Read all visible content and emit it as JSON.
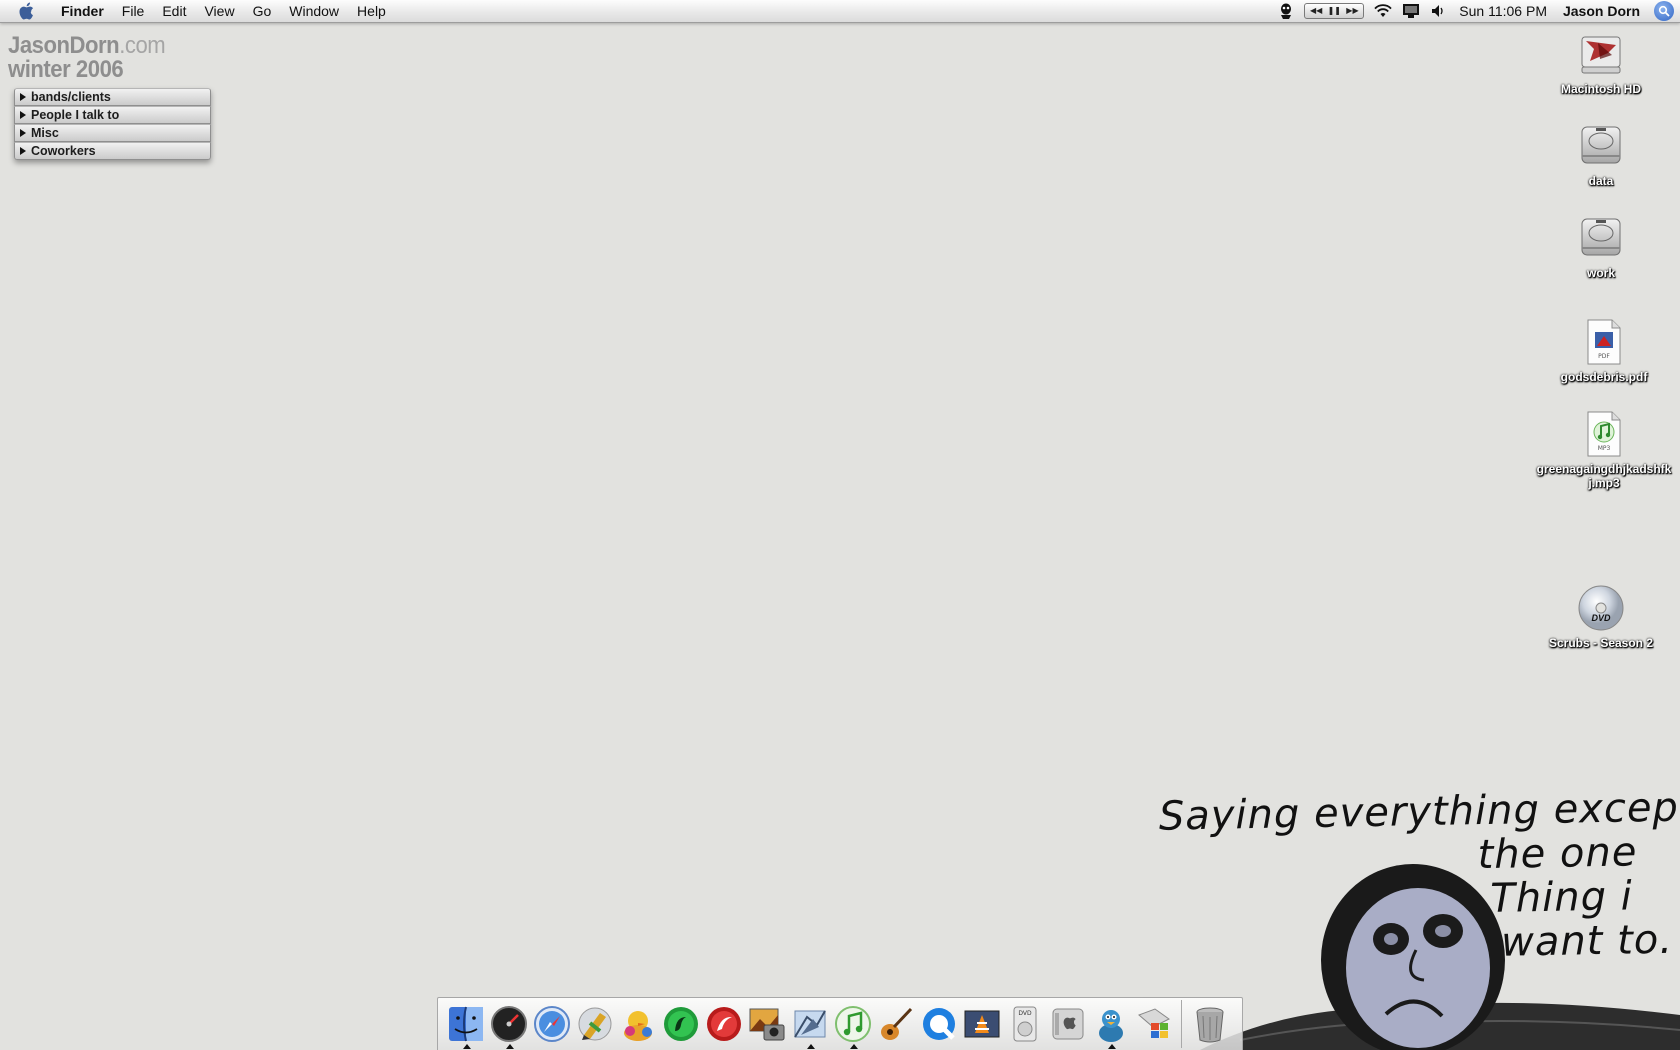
{
  "menubar": {
    "apple_icon": "apple-icon",
    "app_name": "Finder",
    "menus": [
      "File",
      "Edit",
      "View",
      "Go",
      "Window",
      "Help"
    ],
    "status_icons": [
      "script-menu-icon",
      "itunes-transport-control",
      "wifi-icon",
      "display-icon",
      "volume-icon"
    ],
    "clock": "Sun 11:06 PM",
    "user": "Jason Dorn",
    "spotlight_icon": "spotlight-icon"
  },
  "widget": {
    "title_main": "JasonDorn",
    "title_suffix": ".com",
    "subtitle": "winter 2006",
    "items": [
      "bands/clients",
      "People I talk to",
      "Misc",
      "Coworkers"
    ]
  },
  "desktop_icons": [
    {
      "label": "Macintosh HD",
      "icon": "hard-drive-icon"
    },
    {
      "label": "data",
      "icon": "hard-drive-icon"
    },
    {
      "label": "work",
      "icon": "hard-drive-icon"
    },
    {
      "label": "godsdebris.pdf",
      "icon": "pdf-file-icon"
    },
    {
      "label": "greenagaingdhjkadshfkj.mp3",
      "icon": "mp3-file-icon"
    },
    {
      "label": "Scrubs - Season 2",
      "icon": "dvd-icon"
    }
  ],
  "wallpaper": {
    "caption_line1": "Saying everything except",
    "caption_line2": "the one",
    "caption_line3": "Thing i",
    "caption_line4": "want to."
  },
  "dock": {
    "apps": [
      {
        "icon": "finder-icon",
        "running": true
      },
      {
        "icon": "dashboard-icon",
        "running": true
      },
      {
        "icon": "safari-icon",
        "running": false
      },
      {
        "icon": "pencil-art-app-icon",
        "running": false
      },
      {
        "icon": "adium-duck-icon",
        "running": false
      },
      {
        "icon": "green-app-icon",
        "running": false
      },
      {
        "icon": "red-app-icon",
        "running": false
      },
      {
        "icon": "iphoto-icon",
        "running": false
      },
      {
        "icon": "mail-icon",
        "running": true
      },
      {
        "icon": "itunes-icon",
        "running": true
      },
      {
        "icon": "garageband-icon",
        "running": false
      },
      {
        "icon": "quicktime-icon",
        "running": false
      },
      {
        "icon": "vlc-icon",
        "running": false
      },
      {
        "icon": "dvd-player-icon",
        "running": false
      },
      {
        "icon": "system-preferences-icon",
        "running": false
      },
      {
        "icon": "cyberduck-icon",
        "running": true
      },
      {
        "icon": "windows-app-icon",
        "running": false
      }
    ],
    "trash_icon": "trash-icon"
  },
  "colors": {
    "desktop": "#e2e2df",
    "menubar_text": "#111111",
    "widget_title": "#8e8e8e"
  }
}
